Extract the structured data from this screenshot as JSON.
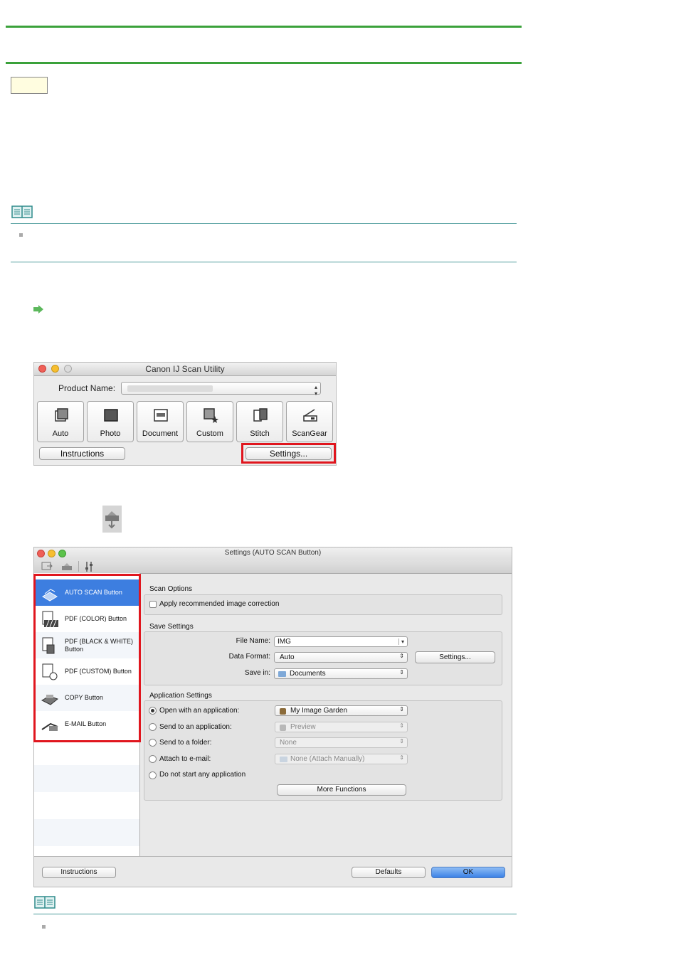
{
  "window1": {
    "title": "Canon IJ Scan Utility",
    "product_label": "Product Name:",
    "product_value": "",
    "tiles": [
      "Auto",
      "Photo",
      "Document",
      "Custom",
      "Stitch",
      "ScanGear"
    ],
    "instructions_label": "Instructions",
    "settings_label": "Settings..."
  },
  "window2": {
    "title": "Settings (AUTO SCAN Button)",
    "sidebar": [
      {
        "label": "AUTO SCAN Button",
        "selected": true
      },
      {
        "label": "PDF (COLOR) Button"
      },
      {
        "label": "PDF (BLACK & WHITE) Button"
      },
      {
        "label": "PDF (CUSTOM) Button"
      },
      {
        "label": "COPY Button"
      },
      {
        "label": "E-MAIL Button"
      }
    ],
    "scan_options": {
      "heading": "Scan Options",
      "apply_correction": "Apply recommended image correction"
    },
    "save_settings": {
      "heading": "Save Settings",
      "file_name_label": "File Name:",
      "file_name_value": "IMG",
      "data_format_label": "Data Format:",
      "data_format_value": "Auto",
      "settings_button": "Settings...",
      "save_in_label": "Save in:",
      "save_in_value": "Documents"
    },
    "app_settings": {
      "heading": "Application Settings",
      "options": [
        {
          "label": "Open with an application:",
          "value": "My Image Garden",
          "selected": true
        },
        {
          "label": "Send to an application:",
          "value": "Preview"
        },
        {
          "label": "Send to a folder:",
          "value": "None"
        },
        {
          "label": "Attach to e-mail:",
          "value": "None (Attach Manually)"
        },
        {
          "label": "Do not start any application"
        }
      ],
      "more_functions": "More Functions"
    },
    "instructions_label": "Instructions",
    "defaults_label": "Defaults",
    "ok_label": "OK"
  },
  "colors": {
    "accent_green": "#3aa13a",
    "highlight_red": "#e0161e",
    "selection_blue": "#3d7ee0"
  }
}
